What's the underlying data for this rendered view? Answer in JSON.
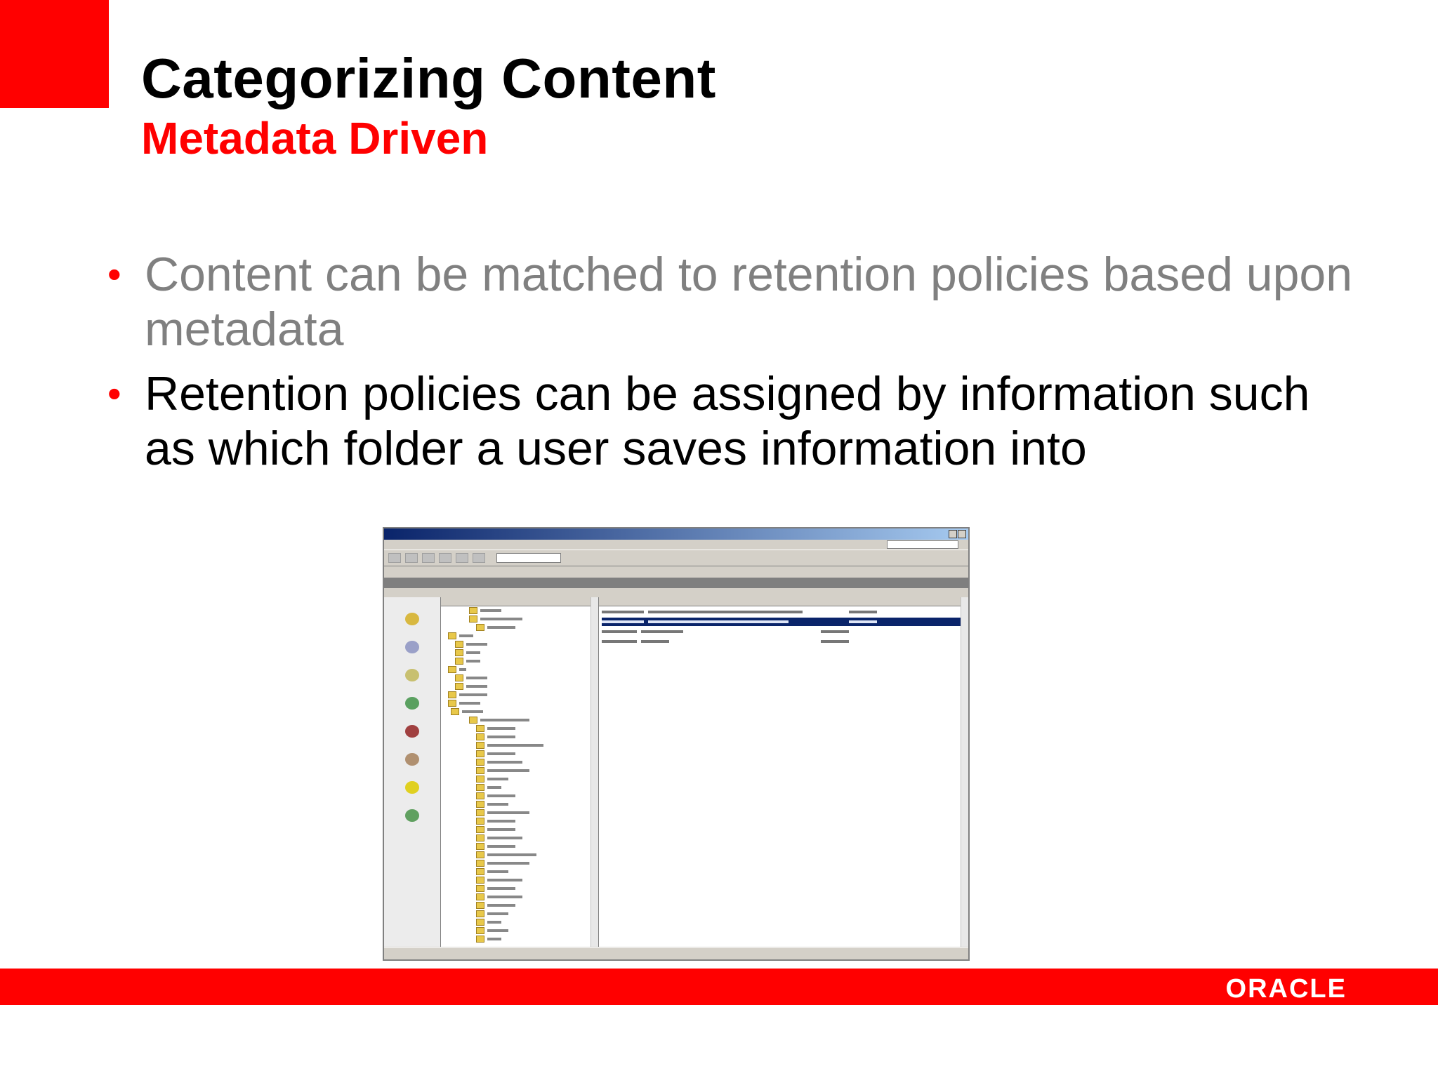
{
  "slide": {
    "title": "Categorizing Content",
    "subtitle": "Metadata Driven",
    "bullets": [
      "Content can be matched to retention policies based upon metadata",
      "Retention policies can be assigned by information such as which folder a user saves information into"
    ],
    "bullet_glyph": "•",
    "logo": "ORACLE"
  },
  "colors": {
    "accent": "#ff0000",
    "bullet_gray": "#808080",
    "text_dark": "#000000"
  },
  "screenshot": {
    "icon": "windows-explorer-screenshot"
  }
}
